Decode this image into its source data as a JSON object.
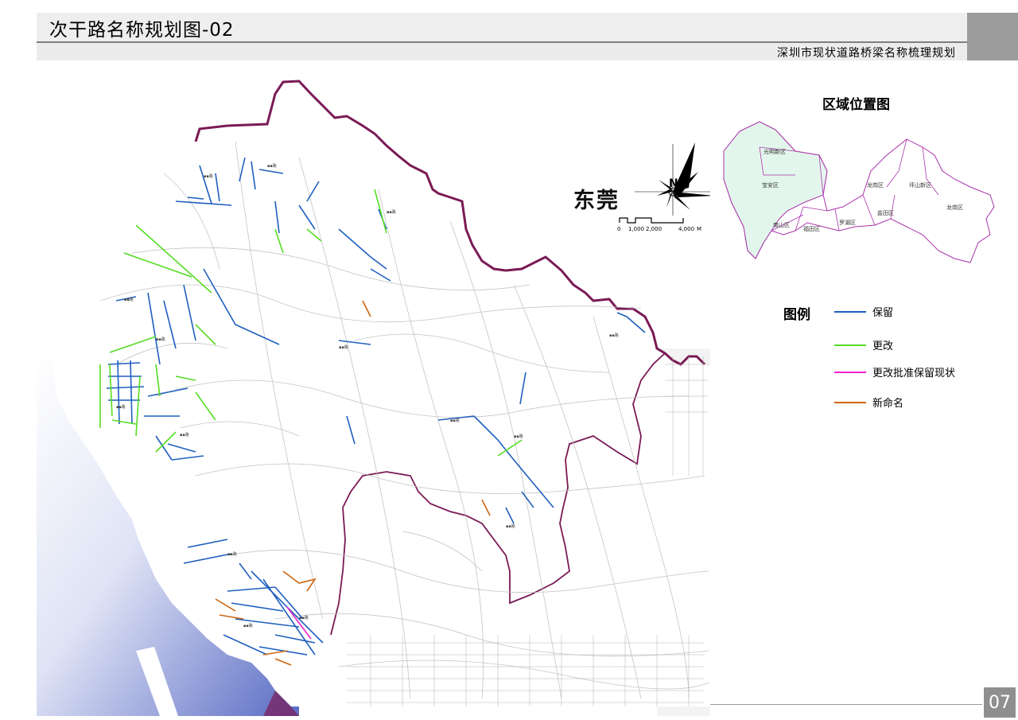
{
  "header": {
    "title": "次干路名称规划图-02",
    "subtitle": "深圳市现状道路桥梁名称梳理规划"
  },
  "map": {
    "neighbor_label": "东莞",
    "north_symbol": "N",
    "scale": {
      "ticks": [
        "0",
        "1,000",
        "2,000",
        "4,000"
      ],
      "unit": "M"
    }
  },
  "location_map": {
    "title": "区域位置图",
    "districts": [
      "光明新区",
      "宝安区",
      "龙岗区",
      "坪山新区",
      "盐田区",
      "龙岗区",
      "南山区",
      "福田区",
      "罗湖区"
    ]
  },
  "legend": {
    "title": "图例",
    "items": [
      {
        "label": "保留",
        "color": "#1f5fbf"
      },
      {
        "label": "更改",
        "color": "#55dd22"
      },
      {
        "label": "更改批准保留现状",
        "color": "#ee22cc"
      },
      {
        "label": "新命名",
        "color": "#cc6611"
      }
    ]
  },
  "colors": {
    "boundary": "#7a1a55",
    "sea_dark": "#5a6cc4",
    "road": "#bdbdbd"
  },
  "page_number": "07"
}
